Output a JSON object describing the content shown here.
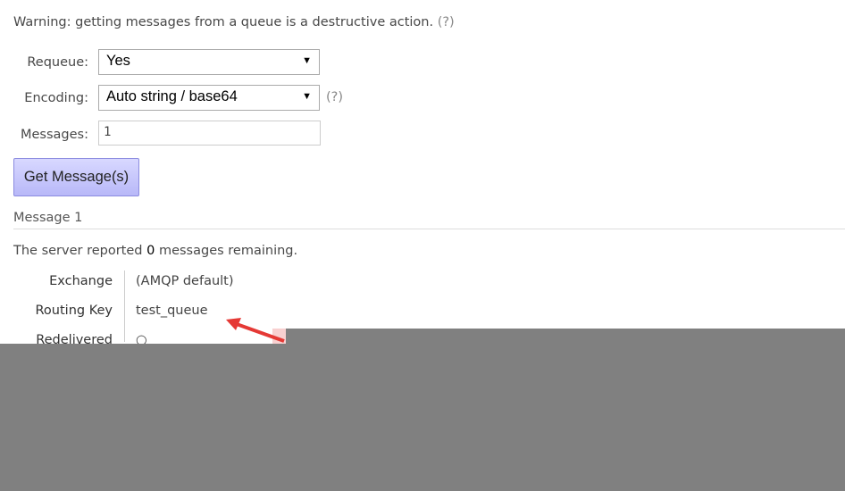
{
  "warning": {
    "text": "Warning: getting messages from a queue is a destructive action.",
    "help": "(?)"
  },
  "form": {
    "requeue": {
      "label": "Requeue:",
      "value": "Yes"
    },
    "encoding": {
      "label": "Encoding:",
      "value": "Auto string / base64",
      "help": "(?)"
    },
    "messages": {
      "label": "Messages:",
      "value": "1"
    },
    "submit_label": "Get Message(s)"
  },
  "message": {
    "heading": "Message 1",
    "remaining_prefix": "The server reported ",
    "remaining_count": "0",
    "remaining_suffix": " messages remaining.",
    "props": [
      {
        "key": "Exchange",
        "value": "(AMQP default)"
      },
      {
        "key": "Routing Key",
        "value": "test_queue"
      },
      {
        "key": "Redelivered",
        "value": "○"
      }
    ]
  },
  "colors": {
    "button": "#c8c8fc",
    "arrow": "#e53935",
    "overlay": "#808080"
  }
}
